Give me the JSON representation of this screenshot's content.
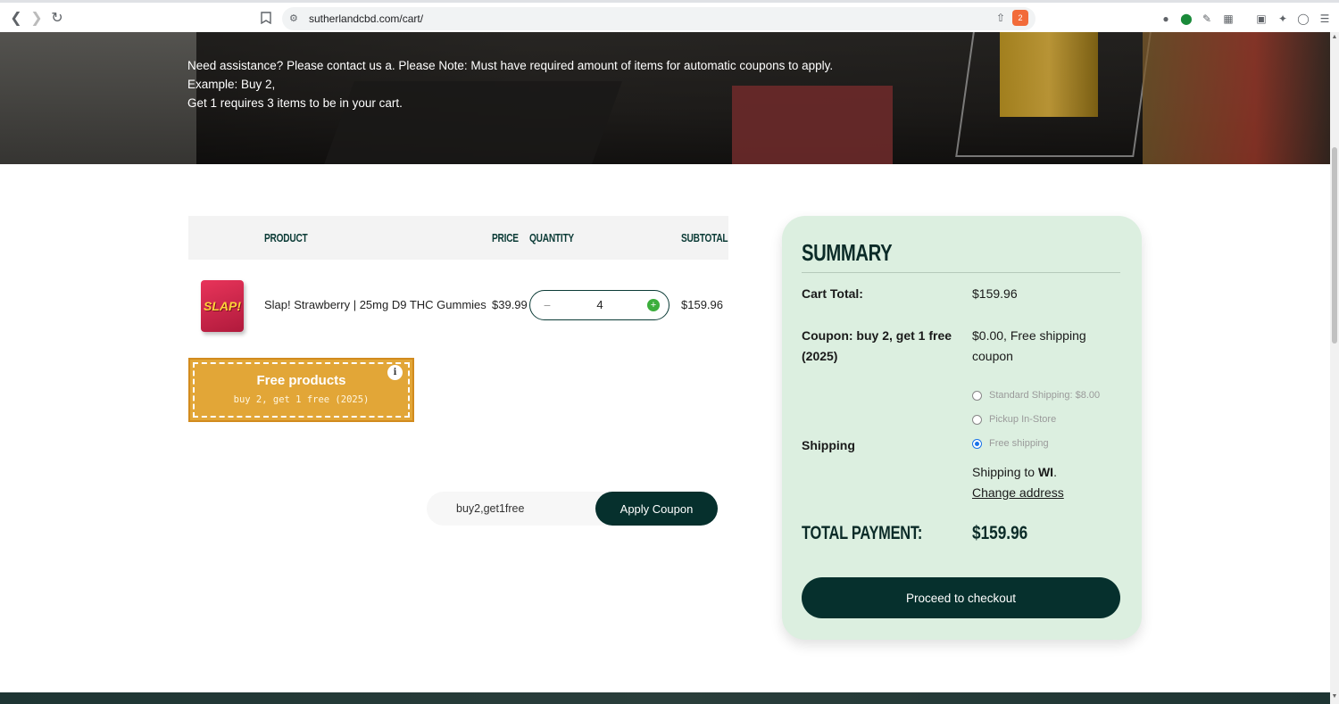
{
  "browser": {
    "url": "sutherlandcbd.com/cart/",
    "badge_count": "2"
  },
  "hero": {
    "notice_line1": "Need assistance? Please contact us a. Please Note: Must have required amount of items for automatic coupons to apply. Example: Buy 2,",
    "notice_line2": "Get 1 requires 3 items to be in your cart."
  },
  "cart": {
    "headers": {
      "product": "PRODUCT",
      "price": "PRICE",
      "quantity": "QUANTITY",
      "subtotal": "SUBTOTAL"
    },
    "items": [
      {
        "thumb_text": "SLAP!",
        "name": "Slap! Strawberry | 25mg D9 THC Gummies",
        "price": "$39.99",
        "quantity": "4",
        "subtotal": "$159.96"
      }
    ],
    "qty_minus": "−",
    "qty_plus": "+"
  },
  "free_products": {
    "title": "Free products",
    "subtitle": "buy 2, get 1 free (2025)",
    "info": "i"
  },
  "coupon": {
    "input_value": "buy2,get1free",
    "apply_label": "Apply Coupon"
  },
  "summary": {
    "title": "SUMMARY",
    "cart_total_label": "Cart Total:",
    "cart_total_value": "$159.96",
    "coupon_label_line1": "Coupon: buy 2, get 1 free",
    "coupon_label_line2": "(2025)",
    "coupon_value_line1": "$0.00, Free shipping",
    "coupon_value_line2": "coupon",
    "shipping_label": "Shipping",
    "shipping_options": [
      {
        "label": "Standard Shipping: $8.00",
        "checked": false
      },
      {
        "label": "Pickup In-Store",
        "checked": false
      },
      {
        "label": "Free shipping",
        "checked": true
      }
    ],
    "shipping_to_prefix": "Shipping to ",
    "shipping_to_state": "WI",
    "shipping_to_suffix": ".",
    "change_address": "Change address",
    "total_label": "TOTAL PAYMENT:",
    "total_value": "$159.96",
    "checkout_label": "Proceed to checkout"
  },
  "colors": {
    "brand_dark": "#06302d",
    "summary_bg": "#dcefe0",
    "free_box": "#e2a637",
    "accent_green": "#3cae3c"
  }
}
